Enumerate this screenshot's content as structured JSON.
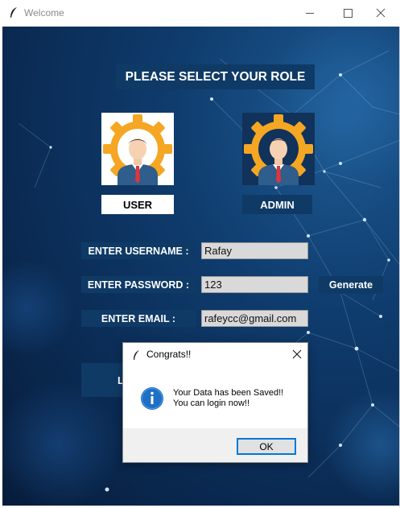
{
  "window": {
    "title": "Welcome"
  },
  "roles": {
    "heading": "PLEASE SELECT YOUR ROLE",
    "user_label": "USER",
    "admin_label": "ADMIN"
  },
  "form": {
    "username_label": "ENTER USERNAME :",
    "username_value": "Rafay",
    "password_label": "ENTER PASSWORD :",
    "password_value": "123",
    "email_label": "ENTER EMAIL :",
    "email_value": "rafeycc@gmail.com",
    "generate_label": "Generate",
    "login_label_partial": "L"
  },
  "dialog": {
    "title": "Congrats!!",
    "message_line1": "Your Data has been Saved!!",
    "message_line2": "You can login now!!",
    "ok_label": "OK"
  },
  "icons": {
    "app_icon": "feather-icon",
    "info_icon": "info-icon",
    "user_avatar": "user-gear-avatar",
    "admin_avatar": "admin-gear-avatar"
  },
  "colors": {
    "panel_blue": "#0f3a66",
    "gear_orange": "#f5a623",
    "dialog_accent": "#0078d7"
  }
}
